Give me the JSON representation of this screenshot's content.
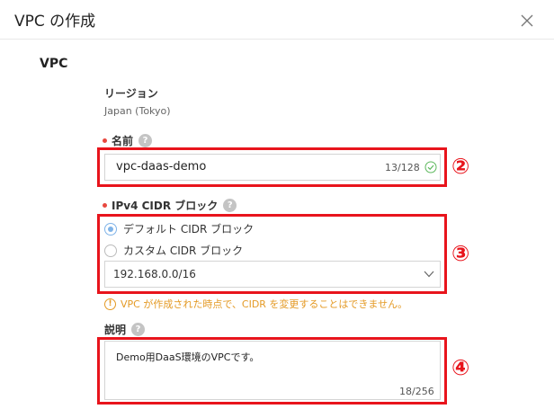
{
  "dialog": {
    "title": "VPC の作成"
  },
  "section": {
    "title": "VPC"
  },
  "region": {
    "label": "リージョン",
    "value": "Japan (Tokyo)"
  },
  "name_field": {
    "label": "名前",
    "value": "vpc-daas-demo",
    "counter": "13/128"
  },
  "cidr": {
    "label": "IPv4 CIDR ブロック",
    "options": [
      {
        "label": "デフォルト CIDR ブロック",
        "selected": true
      },
      {
        "label": "カスタム CIDR ブロック",
        "selected": false
      }
    ],
    "select_value": "192.168.0.0/16",
    "warning": "VPC が作成された時点で、CIDR を変更することはできません。"
  },
  "description_field": {
    "label": "説明",
    "value": "Demo用DaaS環境のVPCです。",
    "counter": "18/256"
  },
  "help_icon_glyph": "?",
  "warning_icon_glyph": "!",
  "annotations": {
    "step2": "②",
    "step3": "③",
    "step4": "④"
  },
  "colors": {
    "highlight": "#e8141c",
    "warning": "#e49a25",
    "required_dot": "#e8483f",
    "radio_checked": "#7fb3e8",
    "check": "#5cb85c"
  }
}
